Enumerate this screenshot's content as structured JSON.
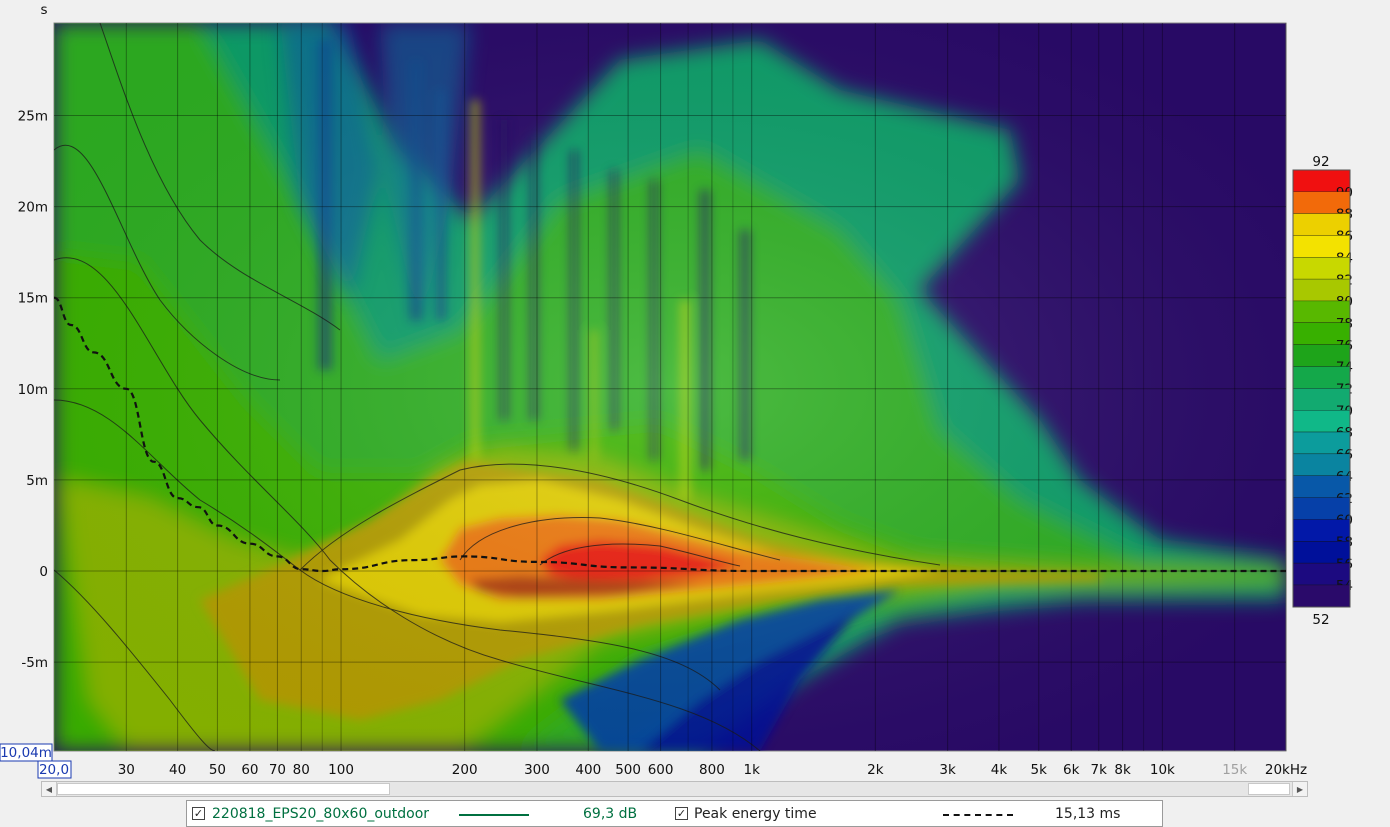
{
  "chart_data": {
    "type": "heatmap",
    "title": "",
    "x_axis": {
      "scale": "log",
      "unit": "kHz",
      "range_label": "20,0",
      "ticks": [
        {
          "v": 30,
          "label": "30"
        },
        {
          "v": 40,
          "label": "40"
        },
        {
          "v": 50,
          "label": "50"
        },
        {
          "v": 60,
          "label": "60"
        },
        {
          "v": 70,
          "label": "70"
        },
        {
          "v": 80,
          "label": "80"
        },
        {
          "v": 100,
          "label": "100"
        },
        {
          "v": 200,
          "label": "200"
        },
        {
          "v": 300,
          "label": "300"
        },
        {
          "v": 400,
          "label": "400"
        },
        {
          "v": 500,
          "label": "500"
        },
        {
          "v": 600,
          "label": "600"
        },
        {
          "v": 800,
          "label": "800"
        },
        {
          "v": 1000,
          "label": "1k"
        },
        {
          "v": 2000,
          "label": "2k"
        },
        {
          "v": 3000,
          "label": "3k"
        },
        {
          "v": 4000,
          "label": "4k"
        },
        {
          "v": 5000,
          "label": "5k"
        },
        {
          "v": 6000,
          "label": "6k"
        },
        {
          "v": 7000,
          "label": "7k"
        },
        {
          "v": 8000,
          "label": "8k"
        },
        {
          "v": 10000,
          "label": "10k"
        },
        {
          "v": 15000,
          "label": "15k",
          "faded": true
        },
        {
          "v": 20000,
          "label": "20kHz"
        }
      ],
      "minor_ticks": [
        90,
        700,
        900,
        9000
      ]
    },
    "y_axis": {
      "unit": "s",
      "range_label": "10,04m",
      "ticks": [
        {
          "v": 25,
          "label": "25m"
        },
        {
          "v": 20,
          "label": "20m"
        },
        {
          "v": 15,
          "label": "15m"
        },
        {
          "v": 10,
          "label": "10m"
        },
        {
          "v": 5,
          "label": "5m"
        },
        {
          "v": 0,
          "label": "0"
        },
        {
          "v": -5,
          "label": "-5m"
        }
      ]
    },
    "color_scale": {
      "min_label": "52",
      "max_label": "92",
      "levels": [
        {
          "label": "90",
          "color": "#f01010"
        },
        {
          "label": "88",
          "color": "#f26a0a"
        },
        {
          "label": "86",
          "color": "#ecd000"
        },
        {
          "label": "84",
          "color": "#f3e200"
        },
        {
          "label": "82",
          "color": "#c8d800"
        },
        {
          "label": "80",
          "color": "#a8c800"
        },
        {
          "label": "78",
          "color": "#58b800"
        },
        {
          "label": "76",
          "color": "#38b000"
        },
        {
          "label": "74",
          "color": "#1ea41a"
        },
        {
          "label": "72",
          "color": "#14a84a"
        },
        {
          "label": "70",
          "color": "#12aa70"
        },
        {
          "label": "68",
          "color": "#10b888"
        },
        {
          "label": "66",
          "color": "#0c9c9c"
        },
        {
          "label": "64",
          "color": "#0a84a0"
        },
        {
          "label": "62",
          "color": "#0858a8"
        },
        {
          "label": "60",
          "color": "#0640a8"
        },
        {
          "label": "58",
          "color": "#0218a8"
        },
        {
          "label": "56",
          "color": "#00109a"
        },
        {
          "label": "54",
          "color": "#1c0a80"
        }
      ],
      "bottom_color": "#2a0a6a"
    },
    "peak_energy_time_ms": [
      [
        20,
        15
      ],
      [
        22,
        13.5
      ],
      [
        25,
        12
      ],
      [
        30,
        10
      ],
      [
        35,
        6
      ],
      [
        40,
        4
      ],
      [
        45,
        3.5
      ],
      [
        50,
        2.5
      ],
      [
        60,
        1.5
      ],
      [
        70,
        0.8
      ],
      [
        80,
        0.1
      ],
      [
        90,
        0
      ],
      [
        100,
        0.1
      ],
      [
        150,
        0.6
      ],
      [
        200,
        0.8
      ],
      [
        300,
        0.5
      ],
      [
        500,
        0.2
      ],
      [
        1000,
        0
      ],
      [
        2000,
        0
      ],
      [
        5000,
        0
      ],
      [
        10000,
        0
      ],
      [
        20000,
        0
      ]
    ],
    "legend": {
      "measurement": {
        "name": "220818_EPS20_80x60_outdoor",
        "value": "69,3 dB",
        "color": "#007040"
      },
      "overlay": {
        "name": "Peak energy time",
        "value": "15,13 ms"
      }
    }
  }
}
